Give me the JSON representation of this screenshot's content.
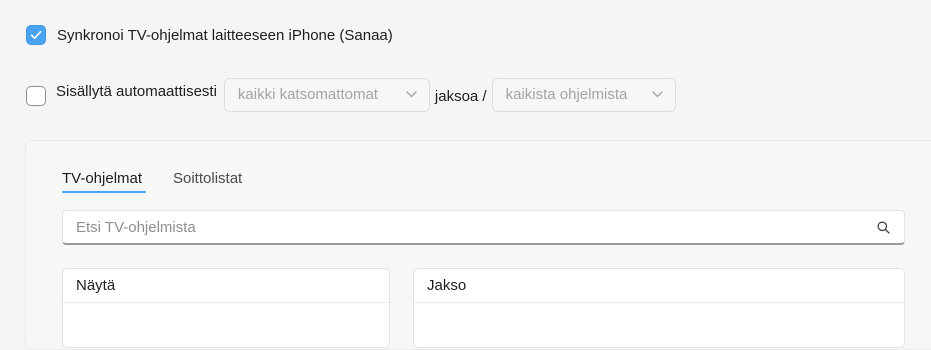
{
  "sync": {
    "checked": true,
    "label": "Synkronoi TV-ohjelmat laitteeseen iPhone (Sanaa)"
  },
  "auto_include": {
    "checked": false,
    "label": "Sisällytä automaattisesti",
    "episodes_dropdown": {
      "value": "kaikki katsomattomat",
      "icon": "chevron-down-icon"
    },
    "connector": "jaksoa /",
    "shows_dropdown": {
      "value": "kaikista ohjelmista",
      "icon": "chevron-down-icon"
    }
  },
  "tabs": [
    {
      "label": "TV-ohjelmat",
      "active": true
    },
    {
      "label": "Soittolistat",
      "active": false
    }
  ],
  "search": {
    "placeholder": "Etsi TV-ohjelmista",
    "value": "",
    "icon": "search-icon"
  },
  "lists": {
    "shows": {
      "header": "Näytä"
    },
    "episodes": {
      "header": "Jakso"
    }
  },
  "colors": {
    "accent": "#4aa3f0",
    "background": "#f5f5f5"
  }
}
